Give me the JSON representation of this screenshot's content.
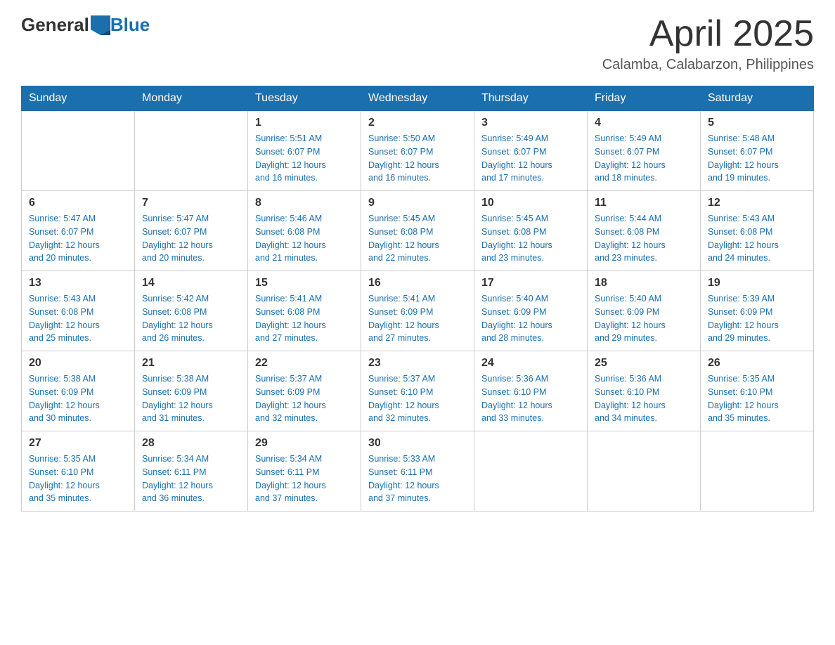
{
  "header": {
    "logo": {
      "general": "General",
      "blue": "Blue"
    },
    "title": "April 2025",
    "location": "Calamba, Calabarzon, Philippines"
  },
  "weekdays": [
    "Sunday",
    "Monday",
    "Tuesday",
    "Wednesday",
    "Thursday",
    "Friday",
    "Saturday"
  ],
  "weeks": [
    [
      {
        "day": "",
        "info": ""
      },
      {
        "day": "",
        "info": ""
      },
      {
        "day": "1",
        "info": "Sunrise: 5:51 AM\nSunset: 6:07 PM\nDaylight: 12 hours\nand 16 minutes."
      },
      {
        "day": "2",
        "info": "Sunrise: 5:50 AM\nSunset: 6:07 PM\nDaylight: 12 hours\nand 16 minutes."
      },
      {
        "day": "3",
        "info": "Sunrise: 5:49 AM\nSunset: 6:07 PM\nDaylight: 12 hours\nand 17 minutes."
      },
      {
        "day": "4",
        "info": "Sunrise: 5:49 AM\nSunset: 6:07 PM\nDaylight: 12 hours\nand 18 minutes."
      },
      {
        "day": "5",
        "info": "Sunrise: 5:48 AM\nSunset: 6:07 PM\nDaylight: 12 hours\nand 19 minutes."
      }
    ],
    [
      {
        "day": "6",
        "info": "Sunrise: 5:47 AM\nSunset: 6:07 PM\nDaylight: 12 hours\nand 20 minutes."
      },
      {
        "day": "7",
        "info": "Sunrise: 5:47 AM\nSunset: 6:07 PM\nDaylight: 12 hours\nand 20 minutes."
      },
      {
        "day": "8",
        "info": "Sunrise: 5:46 AM\nSunset: 6:08 PM\nDaylight: 12 hours\nand 21 minutes."
      },
      {
        "day": "9",
        "info": "Sunrise: 5:45 AM\nSunset: 6:08 PM\nDaylight: 12 hours\nand 22 minutes."
      },
      {
        "day": "10",
        "info": "Sunrise: 5:45 AM\nSunset: 6:08 PM\nDaylight: 12 hours\nand 23 minutes."
      },
      {
        "day": "11",
        "info": "Sunrise: 5:44 AM\nSunset: 6:08 PM\nDaylight: 12 hours\nand 23 minutes."
      },
      {
        "day": "12",
        "info": "Sunrise: 5:43 AM\nSunset: 6:08 PM\nDaylight: 12 hours\nand 24 minutes."
      }
    ],
    [
      {
        "day": "13",
        "info": "Sunrise: 5:43 AM\nSunset: 6:08 PM\nDaylight: 12 hours\nand 25 minutes."
      },
      {
        "day": "14",
        "info": "Sunrise: 5:42 AM\nSunset: 6:08 PM\nDaylight: 12 hours\nand 26 minutes."
      },
      {
        "day": "15",
        "info": "Sunrise: 5:41 AM\nSunset: 6:08 PM\nDaylight: 12 hours\nand 27 minutes."
      },
      {
        "day": "16",
        "info": "Sunrise: 5:41 AM\nSunset: 6:09 PM\nDaylight: 12 hours\nand 27 minutes."
      },
      {
        "day": "17",
        "info": "Sunrise: 5:40 AM\nSunset: 6:09 PM\nDaylight: 12 hours\nand 28 minutes."
      },
      {
        "day": "18",
        "info": "Sunrise: 5:40 AM\nSunset: 6:09 PM\nDaylight: 12 hours\nand 29 minutes."
      },
      {
        "day": "19",
        "info": "Sunrise: 5:39 AM\nSunset: 6:09 PM\nDaylight: 12 hours\nand 29 minutes."
      }
    ],
    [
      {
        "day": "20",
        "info": "Sunrise: 5:38 AM\nSunset: 6:09 PM\nDaylight: 12 hours\nand 30 minutes."
      },
      {
        "day": "21",
        "info": "Sunrise: 5:38 AM\nSunset: 6:09 PM\nDaylight: 12 hours\nand 31 minutes."
      },
      {
        "day": "22",
        "info": "Sunrise: 5:37 AM\nSunset: 6:09 PM\nDaylight: 12 hours\nand 32 minutes."
      },
      {
        "day": "23",
        "info": "Sunrise: 5:37 AM\nSunset: 6:10 PM\nDaylight: 12 hours\nand 32 minutes."
      },
      {
        "day": "24",
        "info": "Sunrise: 5:36 AM\nSunset: 6:10 PM\nDaylight: 12 hours\nand 33 minutes."
      },
      {
        "day": "25",
        "info": "Sunrise: 5:36 AM\nSunset: 6:10 PM\nDaylight: 12 hours\nand 34 minutes."
      },
      {
        "day": "26",
        "info": "Sunrise: 5:35 AM\nSunset: 6:10 PM\nDaylight: 12 hours\nand 35 minutes."
      }
    ],
    [
      {
        "day": "27",
        "info": "Sunrise: 5:35 AM\nSunset: 6:10 PM\nDaylight: 12 hours\nand 35 minutes."
      },
      {
        "day": "28",
        "info": "Sunrise: 5:34 AM\nSunset: 6:11 PM\nDaylight: 12 hours\nand 36 minutes."
      },
      {
        "day": "29",
        "info": "Sunrise: 5:34 AM\nSunset: 6:11 PM\nDaylight: 12 hours\nand 37 minutes."
      },
      {
        "day": "30",
        "info": "Sunrise: 5:33 AM\nSunset: 6:11 PM\nDaylight: 12 hours\nand 37 minutes."
      },
      {
        "day": "",
        "info": ""
      },
      {
        "day": "",
        "info": ""
      },
      {
        "day": "",
        "info": ""
      }
    ]
  ]
}
